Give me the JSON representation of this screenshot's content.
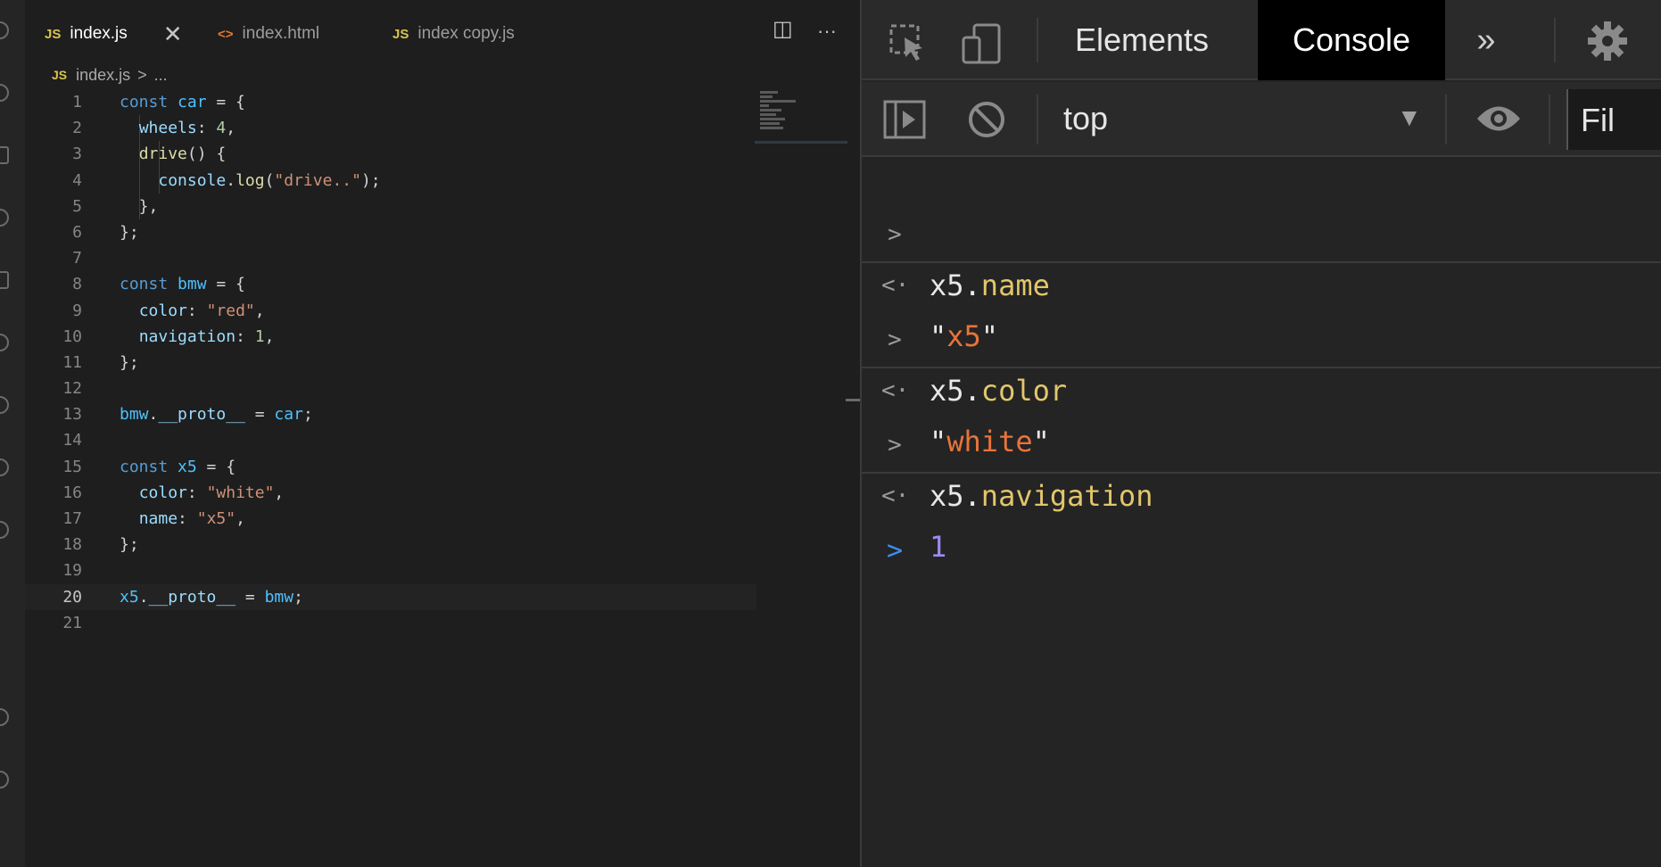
{
  "editor": {
    "tabs": [
      {
        "icon": "JS",
        "label": "index.js",
        "active": true,
        "close": "✕"
      },
      {
        "icon": "<>",
        "label": "index.html",
        "active": false
      },
      {
        "icon": "JS",
        "label": "index copy.js",
        "active": false
      }
    ],
    "actions": {
      "split": "◫",
      "more": "···"
    },
    "breadcrumb": {
      "icon": "JS",
      "file": "index.js",
      "sep": ">",
      "rest": "..."
    },
    "lines": [
      {
        "n": "1"
      },
      {
        "n": "2"
      },
      {
        "n": "3"
      },
      {
        "n": "4"
      },
      {
        "n": "5"
      },
      {
        "n": "6"
      },
      {
        "n": "7"
      },
      {
        "n": "8"
      },
      {
        "n": "9"
      },
      {
        "n": "10"
      },
      {
        "n": "11"
      },
      {
        "n": "12"
      },
      {
        "n": "13"
      },
      {
        "n": "14"
      },
      {
        "n": "15"
      },
      {
        "n": "16"
      },
      {
        "n": "17"
      },
      {
        "n": "18"
      },
      {
        "n": "19"
      },
      {
        "n": "20"
      },
      {
        "n": "21"
      }
    ],
    "code": {
      "l1": [
        "const",
        " ",
        "car",
        " = {"
      ],
      "l2": [
        "  ",
        "wheels",
        ": ",
        "4",
        ","
      ],
      "l3": [
        "  ",
        "drive",
        "() {"
      ],
      "l4": [
        "    ",
        "console",
        ".",
        "log",
        "(",
        "\"drive..\"",
        ");"
      ],
      "l5": [
        "  },"
      ],
      "l6": [
        "};"
      ],
      "l8": [
        "const",
        " ",
        "bmw",
        " = {"
      ],
      "l9": [
        "  ",
        "color",
        ": ",
        "\"red\"",
        ","
      ],
      "l10": [
        "  ",
        "navigation",
        ": ",
        "1",
        ","
      ],
      "l11": [
        "};"
      ],
      "l13": [
        "bmw",
        ".",
        "__proto__",
        " = ",
        "car",
        ";"
      ],
      "l15": [
        "const",
        " ",
        "x5",
        " = {"
      ],
      "l16": [
        "  ",
        "color",
        ": ",
        "\"white\"",
        ","
      ],
      "l17": [
        "  ",
        "name",
        ": ",
        "\"x5\"",
        ","
      ],
      "l18": [
        "};"
      ],
      "l20": [
        "x5",
        ".",
        "__proto__",
        " = ",
        "bmw",
        ";"
      ]
    }
  },
  "devtools": {
    "tabs": {
      "elements": "Elements",
      "console": "Console",
      "more": "»"
    },
    "icons": {
      "inspect": "inspect-icon",
      "device": "device-toolbar-icon",
      "settings": "gear-icon",
      "sidebar": "sidebar-toggle-icon",
      "clear": "clear-console-icon",
      "eye": "live-expression-icon"
    },
    "context": "top",
    "context_arrow": "▼",
    "filter": "Fil",
    "entries": [
      {
        "input_obj": "x5",
        "input_dot": ".",
        "input_prop": "name",
        "output": "\"x5\"",
        "output_type": "string"
      },
      {
        "input_obj": "x5",
        "input_dot": ".",
        "input_prop": "color",
        "output": "\"white\"",
        "output_type": "string"
      },
      {
        "input_obj": "x5",
        "input_dot": ".",
        "input_prop": "navigation",
        "output": "1",
        "output_type": "number"
      }
    ],
    "prompt_symbol": ">",
    "input_symbol": ">",
    "output_symbol": "<·"
  },
  "colors": {
    "string": "#e8743b",
    "number": "#9a8cf0",
    "property": "#e2c66b",
    "prompt": "#3b8ff5"
  }
}
